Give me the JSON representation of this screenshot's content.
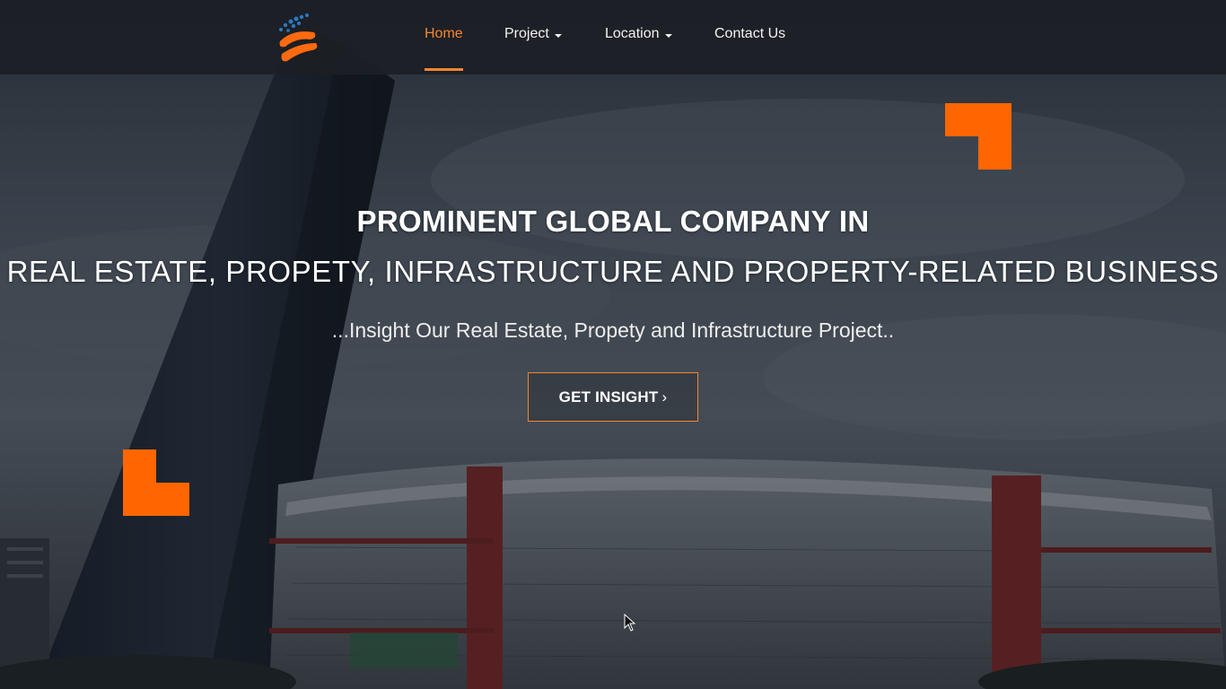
{
  "nav": {
    "items": [
      {
        "label": "Home",
        "active": true,
        "dropdown": false
      },
      {
        "label": "Project",
        "active": false,
        "dropdown": true
      },
      {
        "label": "Location",
        "active": false,
        "dropdown": true
      },
      {
        "label": "Contact Us",
        "active": false,
        "dropdown": false
      }
    ]
  },
  "hero": {
    "headline_1": "PROMINENT GLOBAL COMPANY IN",
    "headline_2": "REAL ESTATE, PROPETY, INFRASTRUCTURE AND PROPERTY-RELATED BUSINESS",
    "tagline": "...Insight Our Real Estate, Propety and Infrastructure Project..",
    "cta_label": "GET INSIGHT",
    "cta_icon": "chevron-right-icon"
  },
  "colors": {
    "accent": "#f7862e",
    "corner_blocks": "#ff6600",
    "logo_blue": "#2b79c2",
    "navbar": "#1c1f25"
  }
}
